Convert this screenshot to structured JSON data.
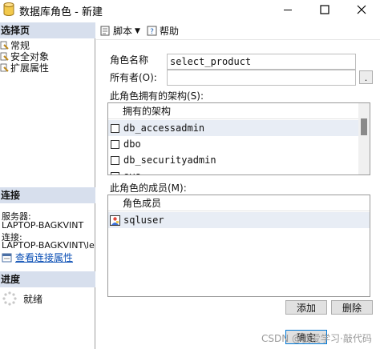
{
  "window": {
    "title": "数据库角色 - 新建",
    "icons": {
      "app": "database-cylinder-icon",
      "minimize": "minimize-icon",
      "maximize": "maximize-icon",
      "close": "close-icon"
    }
  },
  "left_pane": {
    "select_page": {
      "header": "选择页",
      "items": [
        {
          "label": "常规",
          "icon": "page-wrench-icon"
        },
        {
          "label": "安全对象",
          "icon": "page-wrench-icon"
        },
        {
          "label": "扩展属性",
          "icon": "page-wrench-icon"
        }
      ]
    },
    "connection": {
      "header": "连接",
      "server_label": "服务器:",
      "server_value": "LAPTOP-BAGKVINT",
      "connection_label": "连接:",
      "connection_value": "LAPTOP-BAGKVINT\\le",
      "link_label": "查看连接属性"
    },
    "progress": {
      "header": "进度",
      "status": "就绪"
    }
  },
  "toolbar": {
    "script_label": "脚本",
    "help_label": "帮助"
  },
  "form": {
    "role_name_label": "角色名称",
    "role_name_value": "select_product",
    "owner_label": "所有者(O):",
    "owner_value": "",
    "browse_label": "."
  },
  "schemas": {
    "section_label": "此角色拥有的架构(S):",
    "column_header": "拥有的架构",
    "rows": [
      {
        "name": "db_accessadmin",
        "checked": false
      },
      {
        "name": "dbo",
        "checked": false
      },
      {
        "name": "db_securityadmin",
        "checked": false
      },
      {
        "name": "sys",
        "checked": false
      }
    ]
  },
  "members": {
    "section_label": "此角色的成员(M):",
    "column_header": "角色成员",
    "rows": [
      {
        "name": "sqluser",
        "icon": "user-icon"
      }
    ],
    "add_label": "添加",
    "remove_label": "删除"
  },
  "footer": {
    "ok_label": "确定",
    "watermark": "CSDN @我爱学习·敲代码"
  },
  "colors": {
    "section_header_bg": "#d7dfed",
    "link": "#0b4fb5",
    "selected_row": "#e8edf5",
    "default_button_border": "#0078d7"
  }
}
